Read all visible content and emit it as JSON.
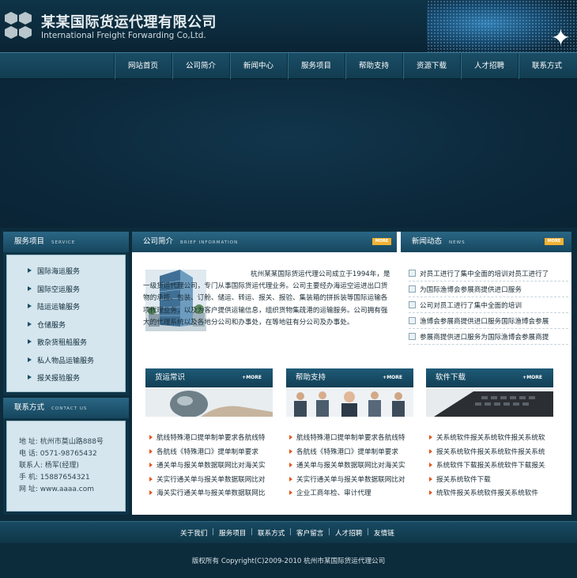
{
  "header": {
    "title_cn": "某某国际货运代理有限公司",
    "title_en": "International Freight Forwarding Co,Ltd."
  },
  "nav": [
    "网站首页",
    "公司简介",
    "新闻中心",
    "服务项目",
    "帮助支持",
    "资源下载",
    "人才招聘",
    "联系方式"
  ],
  "services": {
    "title": "服务项目",
    "title_en": "SERVICE",
    "items": [
      "国际海运服务",
      "国际空运服务",
      "陆运运输服务",
      "仓储服务",
      "散杂货租船服务",
      "私人物品运输服务",
      "报关报验服务"
    ]
  },
  "contact": {
    "title": "联系方式",
    "title_en": "CONTACT US",
    "lines": [
      "地 址: 杭州市莫山路888号",
      "电 话: 0571-98765432",
      "联系人: 杨军(经理)",
      "手 机: 15887654321",
      "网 址: www.aaaa.com"
    ]
  },
  "intro": {
    "title": "公司简介",
    "title_en": "BRIEF INFORMATION",
    "more": "MORE",
    "text": "杭州某某国际货运代理公司成立于1994年，是一级货运代理公司，专门从事国际货运代理业务。公司主要经办海运空运进出口货物的承揽、包装、订舱、储运、转运、报关、报验、集装箱的拼拆装等国际运输各项代理业务，以及为客户提供运输信息，组织货物集疏港的运输服务。公司拥有强大的代理系统以及各地分公司和办事处，在等地驻有分公司及办事处。"
  },
  "news": {
    "title": "新闻动态",
    "title_en": "NEWS",
    "more": "MORE",
    "items": [
      "对员工进行了集中全面的培训对员工进行了",
      "为国际渔博会参展商提供进口服务",
      "公司对员工进行了集中全面的培训",
      "渔博会参展商提供进口服务国际渔博会参展",
      "参展商提供进口服务为国际渔博会参展商提"
    ]
  },
  "cols": [
    {
      "title": "货运常识",
      "more": "+MORE",
      "items": [
        "航线特殊港口提单制单要求各航线特",
        "各航线《特殊港口》提单制单要求",
        "通关单与报关单数据联网比对海关实",
        "关实行通关单与报关单数据联网比对",
        "海关实行通关单与报关单数据联网比"
      ]
    },
    {
      "title": "帮助支持",
      "more": "+MORE",
      "items": [
        "航线特殊港口提单制单要求各航线特",
        "各航线《特殊港口》提单制单要求",
        "通关单与报关单数据联网比对海关实",
        "关实行通关单与报关单数据联网比对",
        "企业工商年检、审计代理"
      ]
    },
    {
      "title": "软件下载",
      "more": "+MORE",
      "items": [
        "关系统软件报关系统软件报关系统软",
        "报关系统软件报关系统软件报关系统",
        "系统软件下载报关系统软件下载报关",
        "报关系统软件下载",
        "统软件报关系统软件报关系统软件"
      ]
    }
  ],
  "footer": {
    "links": [
      "关于我们",
      "服务项目",
      "联系方式",
      "客户留言",
      "人才招聘",
      "友情链"
    ],
    "copyright": "版权所有 Copyright(C)2009-2010 杭州市某国际货运代理公司"
  },
  "colors": {
    "bg": "#0c2b3b",
    "nav": "#1a4e66",
    "accent": "#f2b233",
    "bullet": "#e2551b"
  }
}
